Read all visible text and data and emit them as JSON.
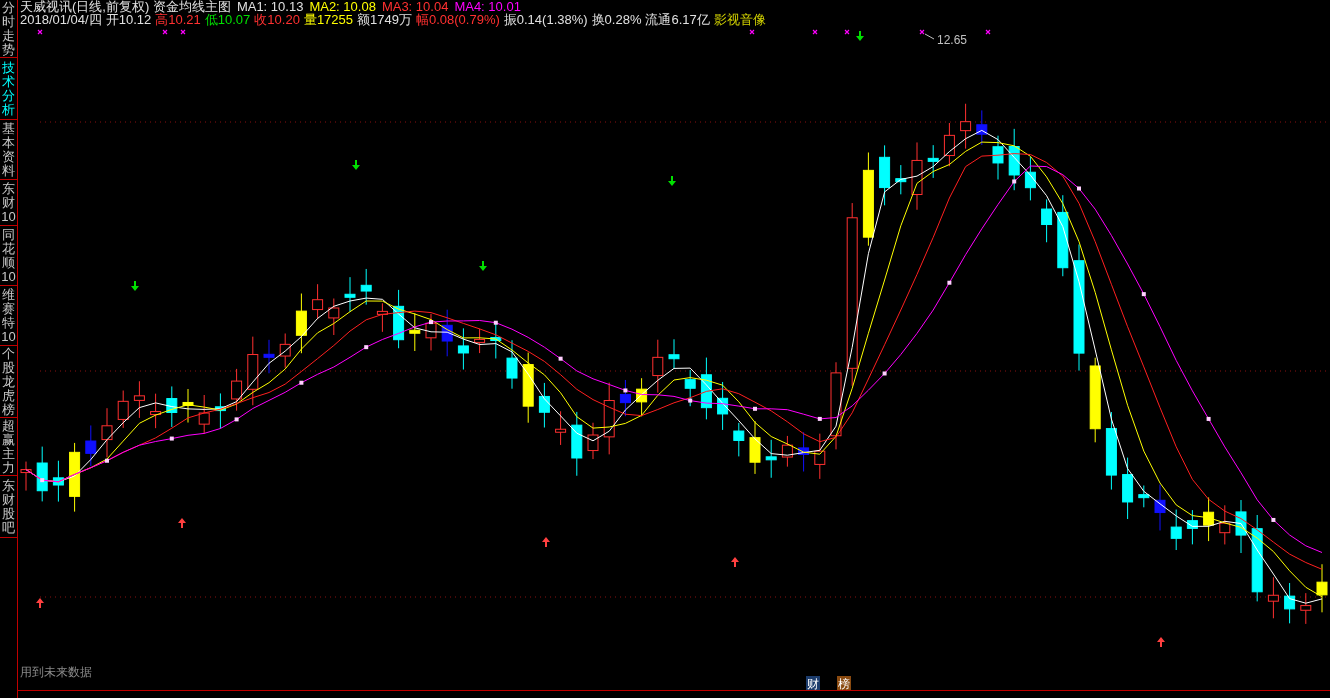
{
  "header": {
    "title": "天威视讯(日线,前复权) 资金均线主图",
    "ma": [
      {
        "label": "MA1: 10.13",
        "color": "#e0e0e0"
      },
      {
        "label": "MA2: 10.08",
        "color": "#ffff00"
      },
      {
        "label": "MA3: 10.04",
        "color": "#ff3030"
      },
      {
        "label": "MA4: 10.01",
        "color": "#ff00ff"
      }
    ]
  },
  "quote": [
    {
      "text": "2018/01/04/四",
      "color": "#e0e0e0"
    },
    {
      "text": "开10.12",
      "color": "#e0e0e0"
    },
    {
      "text": "高10.21",
      "color": "#ff3030"
    },
    {
      "text": "低10.07",
      "color": "#00e000"
    },
    {
      "text": "收10.20",
      "color": "#ff3030"
    },
    {
      "text": "量17255",
      "color": "#ffff00"
    },
    {
      "text": "额1749万",
      "color": "#e0e0e0"
    },
    {
      "text": "幅0.08(0.79%)",
      "color": "#ff3030"
    },
    {
      "text": "振0.14(1.38%)",
      "color": "#e0e0e0"
    },
    {
      "text": "换0.28%",
      "color": "#e0e0e0"
    },
    {
      "text": "流通6.17亿",
      "color": "#e0e0e0"
    },
    {
      "text": "影视音像",
      "color": "#d2d200"
    }
  ],
  "sidebar": {
    "tabs": [
      {
        "label": "分时走势",
        "selected": false
      },
      {
        "label": "技术分析",
        "selected": true
      },
      {
        "label": "基本资料",
        "selected": false
      },
      {
        "label": "东财10",
        "selected": false
      },
      {
        "label": "同花顺10",
        "selected": false
      },
      {
        "label": "维赛特10",
        "selected": false
      },
      {
        "label": "个股龙虎榜",
        "selected": false
      },
      {
        "label": "超赢主力",
        "selected": false
      },
      {
        "label": "东财股吧",
        "selected": false
      }
    ]
  },
  "chart": {
    "high_label": "12.65",
    "notice": "用到未来数据",
    "badges": [
      {
        "label": "财",
        "color": "#1c3c6c"
      },
      {
        "label": "榜",
        "color": "#8a4a10"
      }
    ]
  }
}
